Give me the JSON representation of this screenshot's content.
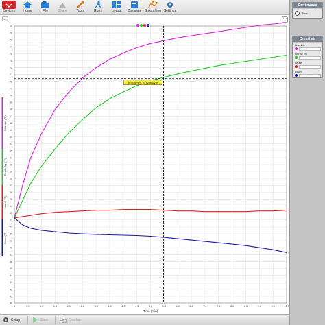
{
  "toolbar": {
    "buttons": [
      {
        "label": "Devices",
        "icon": "devices-icon"
      },
      {
        "label": "Home",
        "icon": "home-icon"
      },
      {
        "label": "File",
        "icon": "file-icon"
      },
      {
        "label": "Share",
        "icon": "share-icon"
      },
      {
        "label": "Tools",
        "icon": "tools-icon"
      },
      {
        "label": "Runs",
        "icon": "runs-icon"
      },
      {
        "label": "Layout",
        "icon": "layout-icon"
      },
      {
        "label": "Calculate",
        "icon": "calculate-icon"
      },
      {
        "label": "Smoothing",
        "icon": "smoothing-icon"
      },
      {
        "label": "Settings",
        "icon": "settings-icon"
      }
    ]
  },
  "panel": {
    "mode_title": "Continuous",
    "time_label": "Time",
    "crosshair_title": "Crosshair",
    "series": [
      {
        "label": "Bramble",
        "color": "#e11ee1",
        "value": "-"
      },
      {
        "label": "Gentle Ivy",
        "color": "#22cc22",
        "value": "-"
      },
      {
        "label": "Laurel",
        "color": "#e02020",
        "value": "-"
      },
      {
        "label": "Room",
        "color": "#1a1aaa",
        "value": "-"
      }
    ]
  },
  "bottombar": {
    "setup": "Setup",
    "start": "Start",
    "overlap": "Overlap"
  },
  "legend_colors": [
    "#e11ee1",
    "#22cc22",
    "#e02020",
    "#1a1aaa"
  ],
  "image_placeholder": "Img",
  "chart_data": {
    "type": "line",
    "xlabel": "Time (min)",
    "xlim": [
      0,
      10
    ],
    "ylim": [
      40,
      80
    ],
    "x_ticks": [
      "0",
      "0.5",
      "1.0",
      "1.5",
      "2.0",
      "2.5",
      "3.0",
      "3.5",
      "4.0",
      "4.5",
      "5.0",
      "5.5",
      "6.0",
      "6.5",
      "7.0",
      "7.5",
      "8.0",
      "8.5",
      "9.0",
      "9.5",
      "10.0"
    ],
    "y_ticks": [
      40,
      41,
      42,
      43,
      44,
      45,
      46,
      47,
      48,
      49,
      50,
      51,
      52,
      53,
      54,
      55,
      56,
      57,
      58,
      59,
      60,
      61,
      62,
      63,
      64,
      65,
      66,
      67,
      68,
      69,
      70,
      71,
      72,
      73,
      74,
      75,
      76,
      77,
      78,
      79,
      80
    ],
    "crosshair": {
      "x": 5.479,
      "y": 72.4,
      "label": "(x=5.479m, y=72.40223)"
    },
    "series": [
      {
        "name": "Bramble (°F)",
        "color": "#e11ee1",
        "x": [
          0,
          0.3,
          0.6,
          1.0,
          1.5,
          2.0,
          2.5,
          3.0,
          3.5,
          4.0,
          4.5,
          5.0,
          5.5,
          6.0,
          6.5,
          7.0,
          7.5,
          8.0,
          8.5,
          9.0,
          9.5,
          10.0
        ],
        "y": [
          52.3,
          57.0,
          61.0,
          64.5,
          68.0,
          70.5,
          72.5,
          74.0,
          75.2,
          76.1,
          76.9,
          77.5,
          77.9,
          78.3,
          78.6,
          78.9,
          79.2,
          79.5,
          79.8,
          80.1,
          80.3,
          80.5
        ]
      },
      {
        "name": "Gentle Ivy (°F)",
        "color": "#22cc22",
        "x": [
          0,
          0.3,
          0.6,
          1.0,
          1.5,
          2.0,
          2.5,
          3.0,
          3.5,
          4.0,
          4.5,
          5.0,
          5.5,
          6.0,
          6.5,
          7.0,
          7.5,
          8.0,
          8.5,
          9.0,
          9.5,
          10.0
        ],
        "y": [
          52.3,
          54.8,
          57.3,
          59.8,
          62.3,
          64.6,
          66.5,
          68.2,
          69.5,
          70.5,
          71.4,
          72.1,
          72.6,
          73.1,
          73.5,
          73.9,
          74.3,
          74.6,
          74.9,
          75.2,
          75.5,
          75.8
        ]
      },
      {
        "name": "Laurel (°F)",
        "color": "#e02020",
        "x": [
          0,
          0.5,
          1.0,
          1.5,
          2.0,
          2.5,
          3.0,
          3.5,
          4.0,
          4.5,
          5.0,
          5.5,
          6.0,
          6.5,
          7.0,
          7.5,
          8.0,
          8.5,
          9.0,
          9.5,
          10.0
        ],
        "y": [
          52.3,
          52.6,
          52.9,
          53.1,
          53.2,
          53.3,
          53.4,
          53.4,
          53.5,
          53.5,
          53.5,
          53.4,
          53.3,
          53.3,
          53.2,
          53.2,
          53.2,
          53.2,
          53.3,
          53.3,
          53.4
        ]
      },
      {
        "name": "Room (°F)",
        "color": "#1a1aaa",
        "x": [
          0,
          0.3,
          0.6,
          1.0,
          1.5,
          2.0,
          2.5,
          3.0,
          3.5,
          4.0,
          4.5,
          5.0,
          5.5,
          6.0,
          6.5,
          7.0,
          7.5,
          8.0,
          8.5,
          9.0,
          9.5,
          10.0
        ],
        "y": [
          52.3,
          51.3,
          50.8,
          50.5,
          50.3,
          50.1,
          50.0,
          49.9,
          49.85,
          49.8,
          49.75,
          49.65,
          49.5,
          49.3,
          49.1,
          48.9,
          48.7,
          48.5,
          48.3,
          48.0,
          47.7,
          47.3
        ]
      }
    ]
  }
}
